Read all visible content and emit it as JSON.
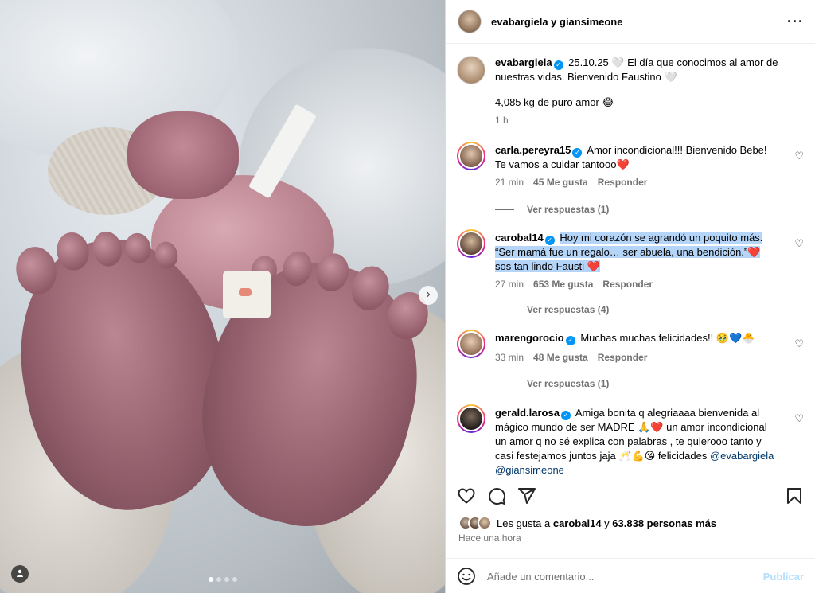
{
  "header": {
    "title": "evabargiela y giansimeone",
    "more_icon": "more-horizontal-icon"
  },
  "caption": {
    "username": "evabargiela",
    "text_line1": "25.10.25 🤍 El día que conocimos al amor de",
    "text_line2": "nuestras vidas. Bienvenido Faustino 🤍",
    "text_line3": "4,085 kg de puro amor 😂",
    "time": "1 h"
  },
  "comments": [
    {
      "username": "carla.pereyra15",
      "line1": "Amor incondicional!!! Bienvenido Bebe!",
      "line2": "Te vamos a cuidar tantooo❤️",
      "time": "21 min",
      "likes": "45 Me gusta",
      "reply": "Responder",
      "replies": "Ver respuestas (1)"
    },
    {
      "username": "carobal14",
      "line1": "Hoy mi corazón se agrandó un poquito más.",
      "line2": "“Ser mamá fue un regalo… ser abuela, una bendición.”❤️",
      "line3": "sos tan lindo Fausti ❤️",
      "time": "27 min",
      "likes": "653 Me gusta",
      "reply": "Responder",
      "replies": "Ver respuestas (4)"
    },
    {
      "username": "marengorocio",
      "line1": "Muchas muchas felicidades!! 🥹💙🐣",
      "time": "33 min",
      "likes": "48 Me gusta",
      "reply": "Responder",
      "replies": "Ver respuestas (1)"
    },
    {
      "username": "gerald.larosa",
      "line1": "Amiga bonita q alegriaaaa bienvenida al",
      "line2": "mágico mundo de ser MADRE 🙏❤️ un amor incondicional",
      "line3": "un amor q no sé explica con palabras , te quierooo tanto y",
      "line4": "casi festejamos juntos jaja 🥂💪😘 felicidades",
      "mention1": "@evabargiela",
      "mention2": "@giansimeone"
    }
  ],
  "actions": {
    "likes_prefix": "Les gusta a",
    "likes_user": "carobal14",
    "likes_and": "y",
    "likes_count": "63.838 personas más",
    "time_ago": "Hace una hora"
  },
  "add_comment": {
    "placeholder": "Añade un comentario...",
    "publish": "Publicar"
  },
  "carousel": {
    "total": 4,
    "active": 1
  }
}
